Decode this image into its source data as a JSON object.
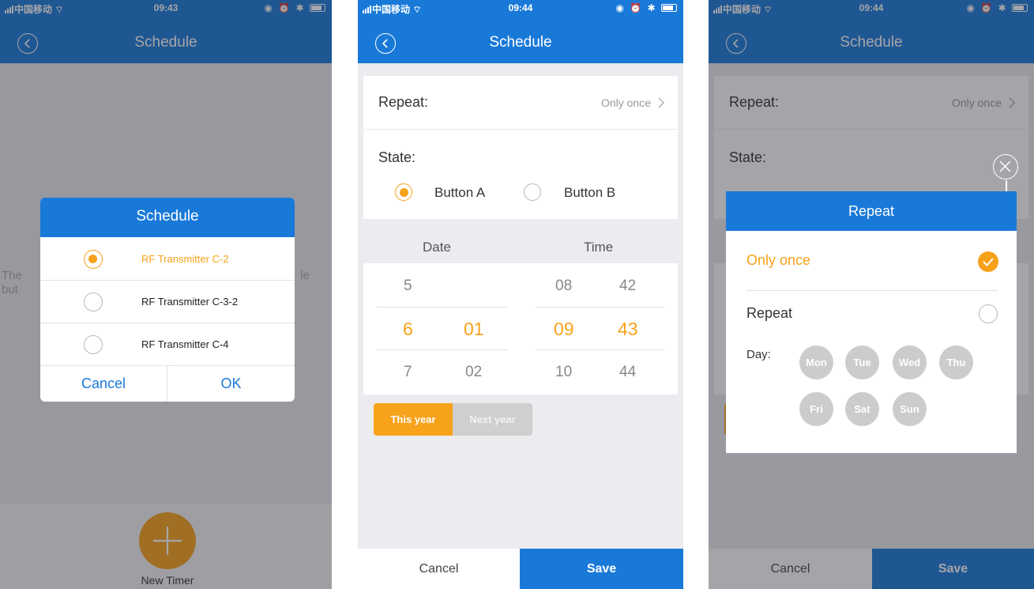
{
  "status1": {
    "carrier": "中国移动",
    "time": "09:43"
  },
  "status2": {
    "carrier": "中国移动",
    "time": "09:44"
  },
  "status3": {
    "carrier": "中国移动",
    "time": "09:44"
  },
  "screen1": {
    "title": "Schedule",
    "bg_text_left_1": "The",
    "bg_text_left_2": "but",
    "bg_text_right": "le",
    "dialog": {
      "title": "Schedule",
      "options": [
        {
          "label": "RF Transmitter C-2",
          "selected": true
        },
        {
          "label": "RF Transmitter C-3-2",
          "selected": false
        },
        {
          "label": "RF Transmitter C-4",
          "selected": false
        }
      ],
      "cancel": "Cancel",
      "ok": "OK"
    },
    "fab_label": "New Timer"
  },
  "screen2": {
    "title": "Schedule",
    "repeat_label": "Repeat:",
    "repeat_value": "Only once",
    "state_label": "State:",
    "button_a": "Button A",
    "button_b": "Button B",
    "date_header": "Date",
    "time_header": "Time",
    "picker": {
      "month": [
        "5",
        "6",
        "7"
      ],
      "day": [
        "",
        "01",
        "02"
      ],
      "hour": [
        "08",
        "09",
        "10"
      ],
      "minute": [
        "42",
        "43",
        "44"
      ]
    },
    "this_year": "This year",
    "next_year": "Next year",
    "cancel": "Cancel",
    "save": "Save"
  },
  "screen3": {
    "title": "Schedule",
    "repeat_label": "Repeat:",
    "repeat_value": "Only once",
    "state_label": "State:",
    "modal": {
      "title": "Repeat",
      "only_once": "Only once",
      "repeat": "Repeat",
      "day_label": "Day:",
      "days": [
        "Mon",
        "Tue",
        "Wed",
        "Thu",
        "Fri",
        "Sat",
        "Sun"
      ]
    },
    "cancel": "Cancel",
    "save": "Save"
  },
  "colors": {
    "blue": "#1979d8",
    "orange": "#f7a21b",
    "gray_day": "#cccccc"
  }
}
